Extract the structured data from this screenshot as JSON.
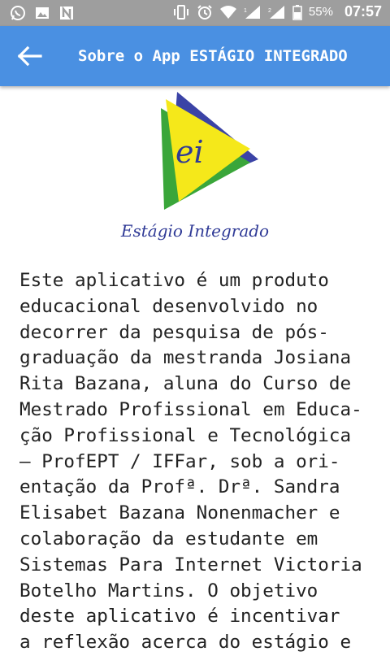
{
  "status_bar": {
    "battery": "55%",
    "time": "07:57",
    "icons": [
      "whatsapp-icon",
      "image-icon",
      "n-app-icon",
      "vibrate-icon",
      "alarm-icon",
      "wifi-icon",
      "signal-icon",
      "signal-icon",
      "battery-icon"
    ]
  },
  "appbar": {
    "title": "Sobre o App ESTÁGIO INTEGRADO",
    "back_icon": "arrow-back-icon",
    "color": "#4a90e2"
  },
  "logo": {
    "mark_text": "ei",
    "caption": "Estágio Integrado",
    "colors": {
      "blue": "#3b43a6",
      "green": "#3aa63a",
      "yellow": "#f5e81a"
    }
  },
  "content": {
    "lines": [
      "Este aplicativo é um produto",
      "educacional desenvolvido no",
      "decorrer da pesquisa de pós-",
      "graduação da mestranda Josiana",
      "Rita Bazana, aluna do Curso de",
      "Mestrado Profissional em Educa-",
      "ção Profissional e Tecnológica",
      "– ProfEPT / IFFar, sob a ori-",
      "entação da Profª. Drª. Sandra",
      "Elisabet Bazana Nonenmacher e",
      "colaboração da estudante em",
      "Sistemas Para Internet Victoria",
      "Botelho Martins. O objetivo",
      "deste aplicativo é incentivar",
      "a reflexão acerca do estágio e"
    ]
  }
}
